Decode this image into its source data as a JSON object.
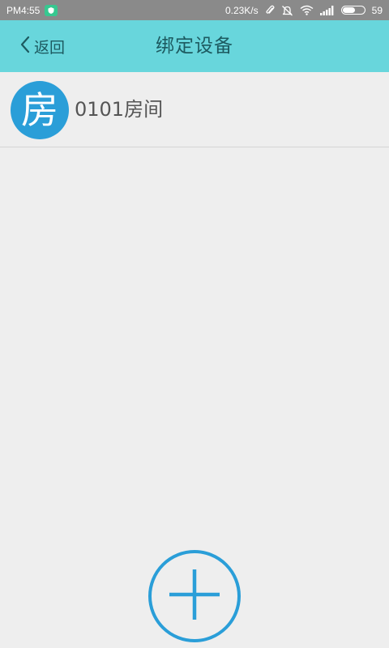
{
  "status_bar": {
    "time": "PM4:55",
    "network_speed": "0.23K/s",
    "battery_level": "59",
    "icons": [
      "app-notification-icon",
      "attachment-icon",
      "bell-muted-icon",
      "wifi-icon",
      "signal-icon",
      "battery-icon"
    ]
  },
  "header": {
    "back_label": "返回",
    "title": "绑定设备",
    "background_color": "#68d6dc",
    "text_color": "#1d5a60"
  },
  "devices": [
    {
      "avatar_text": "房",
      "name": "0101房间",
      "avatar_color": "#2a9ed8"
    }
  ],
  "add_button": {
    "icon": "plus-icon",
    "color": "#2a9ed8"
  }
}
